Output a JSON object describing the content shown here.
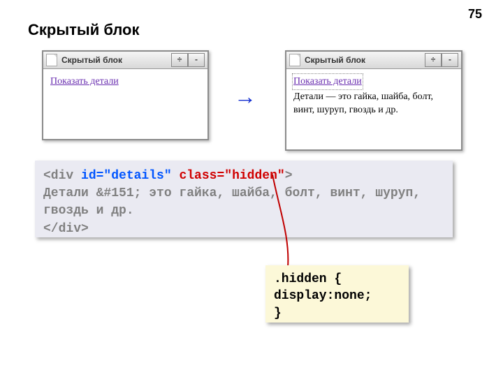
{
  "page_number": "75",
  "title": "Скрытый блок",
  "browser_left": {
    "title": "Скрытый блок",
    "link": "Показать детали",
    "btn1": "÷",
    "btn2": "-"
  },
  "browser_right": {
    "title": "Скрытый блок",
    "link": "Показать детали",
    "details": "Детали — это гайка, шайба, болт, винт, шуруп, гвоздь и др.",
    "btn1": "÷",
    "btn2": "-"
  },
  "arrow": "→",
  "code_html": {
    "open1": "<div ",
    "id_attr": "id=\"details\"",
    "space": " ",
    "class_attr": "class=\"hidden\"",
    "open2": ">",
    "body": "Детали &#151; это гайка, шайба, болт, винт, шуруп, гвоздь и др.",
    "close": "</div>"
  },
  "code_css": {
    "l1": ".hidden {",
    "l2": " display:none;",
    "l3": "}"
  }
}
